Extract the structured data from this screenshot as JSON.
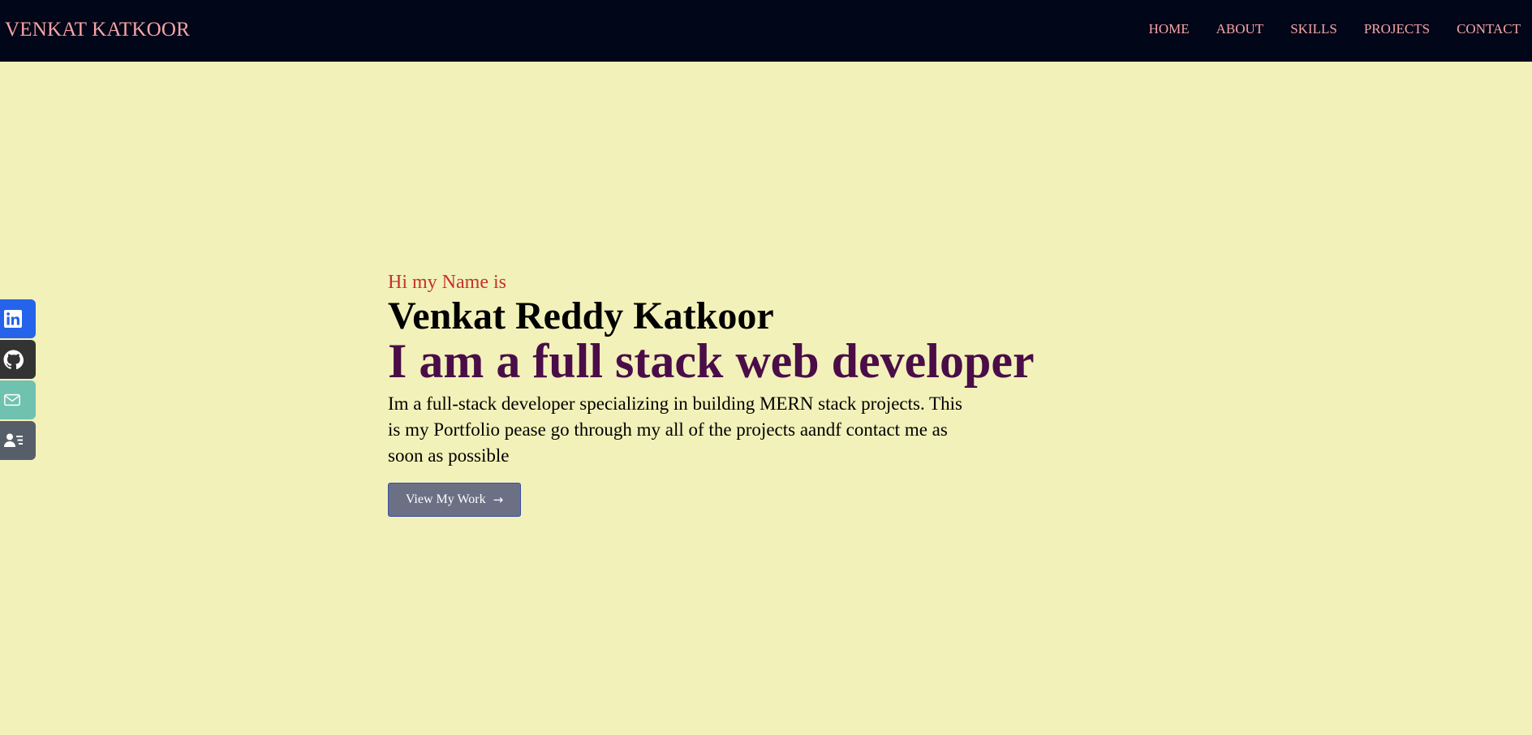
{
  "navbar": {
    "brand": "VENKAT KATKOOR",
    "links": [
      "HOME",
      "ABOUT",
      "SKILLS",
      "PROJECTS",
      "CONTACT"
    ]
  },
  "social": [
    {
      "icon": "linkedin-icon",
      "color": "#2563eb"
    },
    {
      "icon": "github-icon",
      "color": "#333333"
    },
    {
      "icon": "mail-icon",
      "color": "#6fc2b0"
    },
    {
      "icon": "resume-icon",
      "color": "#565f69"
    }
  ],
  "hero": {
    "greeting": "Hi my Name is",
    "name": "Venkat Reddy Katkoor",
    "role": "I am a full stack web developer",
    "description": "Im a full-stack developer specializing in building MERN stack projects. This is my Portfolio pease go through my all of the projects aandf contact me as soon as possible",
    "button_label": "View My Work",
    "button_arrow": "→"
  },
  "colors": {
    "background": "#f2f1b9",
    "navbar": "#010619",
    "nav_text": "#f8a4a4",
    "greeting": "#c53030",
    "role": "#4a0d48",
    "button": "#6b7085"
  }
}
